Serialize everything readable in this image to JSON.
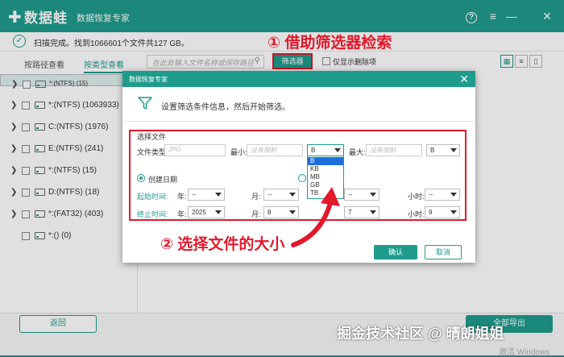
{
  "app": {
    "logo": "数据蛙",
    "title": "数据恢复专家",
    "help_icon": "?",
    "menu_icon": "≡",
    "min_icon": "—",
    "close_icon": "✕"
  },
  "status": {
    "text": "扫描完成。找到1066601个文件共127 GB。"
  },
  "annotations": {
    "step1": "① 借助筛选器检索",
    "step2": "② 选择文件的大小"
  },
  "tabs": {
    "by_path": "按路径查看",
    "by_type": "按类型查看"
  },
  "toolbar": {
    "search_placeholder": "在此处输入文件名称或保存路径",
    "filter_label": "筛选器",
    "show_deleted_label": "仅显示删除项"
  },
  "drives": [
    {
      "label": "*:(NTFS) (15)",
      "expand": true,
      "selected": true
    },
    {
      "label": "*:(NTFS) (1063933)",
      "expand": true
    },
    {
      "label": "C:(NTFS) (1976)",
      "expand": true
    },
    {
      "label": "E:(NTFS) (241)",
      "expand": true
    },
    {
      "label": "*:(NTFS) (15)",
      "expand": true
    },
    {
      "label": "D:(NTFS) (18)",
      "expand": true
    },
    {
      "label": "*:(FAT32) (403)",
      "expand": true
    },
    {
      "label": "*:() (0)",
      "expand": false
    }
  ],
  "footer": {
    "back_label": "返回",
    "export_label": "全部导出"
  },
  "watermark": "掘金技术社区 @ 晴朗姐姐",
  "activate_windows": "激活 Windows",
  "dialog": {
    "title": "数据恢复专家",
    "close_icon": "✕",
    "description": "设置筛选条件信息，然后开始筛选。",
    "section_title": "选择文件",
    "file_type_label": "文件类型:",
    "file_type_placeholder": "JPG",
    "min_label": "最小:",
    "min_placeholder": "没有限制",
    "min_unit": "B",
    "max_label": "最大:",
    "max_placeholder": "没有限制",
    "max_unit": "B",
    "size_units": [
      "B",
      "KB",
      "MB",
      "GB",
      "TB"
    ],
    "created_date_label": "创建日期",
    "start_time_label": "起始时间:",
    "end_time_label": "终止时间:",
    "year_label": "年:",
    "month_label": "月:",
    "hour_label": "小时:",
    "start_year": "--",
    "start_month": "--",
    "start_hour": "--",
    "start_extra": "--",
    "end_year": "2025",
    "end_month": "8",
    "end_extra": "7",
    "end_hour": "9",
    "confirm_label": "确认",
    "cancel_label": "取消"
  },
  "colors": {
    "brand": "#1f9b8c",
    "annotation": "#e3192b",
    "highlight": "#1e6fd9"
  }
}
